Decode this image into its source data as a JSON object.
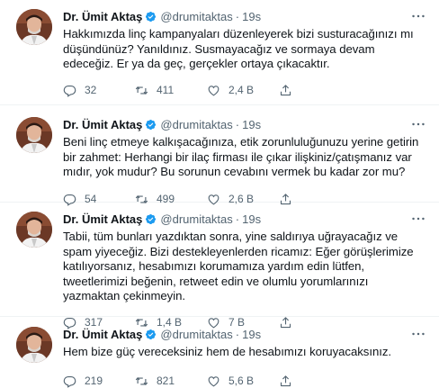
{
  "colors": {
    "name": "#0f1419",
    "secondary": "#536471",
    "verified": "#1d9bf0",
    "border": "#eff3f4"
  },
  "icons": {
    "reply": "reply-icon",
    "retweet": "retweet-icon",
    "like": "heart-icon",
    "share": "share-icon",
    "more": "more-icon",
    "verified": "verified-badge-icon"
  },
  "tweets": [
    {
      "name": "Dr. Ümit Aktaş",
      "handle": "@drumitaktas",
      "dot": "·",
      "time": "19s",
      "text": "Hakkımızda linç kampanyaları düzenleyerek bizi susturacağınızı mı düşündünüz? Yanıldınız. Susmayacağız ve sormaya devam edeceğiz. Er ya da geç, gerçekler ortaya çıkacaktır.",
      "replies": "32",
      "retweets": "411",
      "likes": "2,4 B"
    },
    {
      "name": "Dr. Ümit Aktaş",
      "handle": "@drumitaktas",
      "dot": "·",
      "time": "19s",
      "text": "Beni linç etmeye kalkışacağınıza, etik zorunluluğunuzu yerine getirin bir zahmet: Herhangi bir ilaç firması ile çıkar ilişkiniz/çatışmanız var mıdır, yok mudur? Bu sorunun cevabını vermek bu kadar zor mu?",
      "replies": "54",
      "retweets": "499",
      "likes": "2,6 B"
    },
    {
      "name": "Dr. Ümit Aktaş",
      "handle": "@drumitaktas",
      "dot": "·",
      "time": "19s",
      "text": "Tabii, tüm bunları yazdıktan sonra, yine saldırıya uğrayacağız ve spam yiyeceğiz. Bizi destekleyenlerden ricamız: Eğer görüşlerimize katılıyorsanız, hesabımızı korumamıza yardım edin lütfen, tweetlerimizi beğenin, retweet edin ve olumlu yorumlarınızı yazmaktan çekinmeyin.",
      "replies": "317",
      "retweets": "1,4 B",
      "likes": "7 B"
    },
    {
      "name": "Dr. Ümit Aktaş",
      "handle": "@drumitaktas",
      "dot": "·",
      "time": "19s",
      "text": "Hem bize güç vereceksiniz hem de hesabımızı koruyacaksınız.",
      "replies": "219",
      "retweets": "821",
      "likes": "5,6 B"
    }
  ]
}
